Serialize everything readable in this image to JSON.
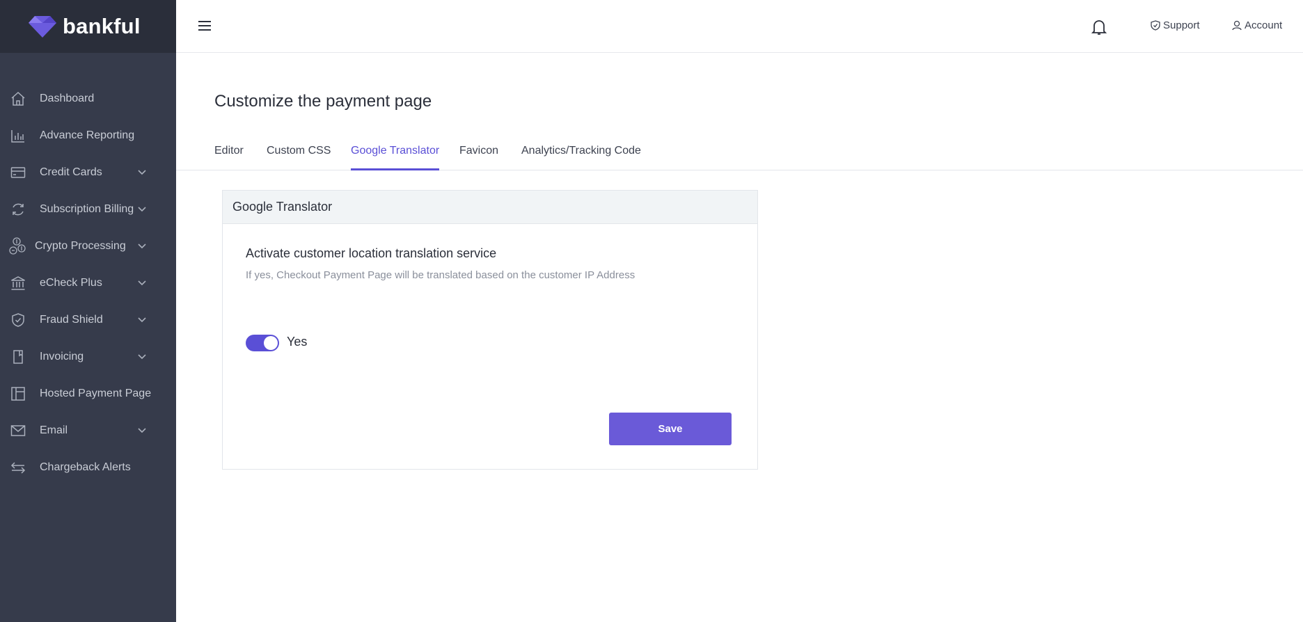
{
  "brand": {
    "name": "bankful",
    "accent": "#5a4fd6"
  },
  "sidebar": {
    "items": [
      {
        "label": "Dashboard",
        "icon": "home-icon",
        "has_submenu": false
      },
      {
        "label": "Advance Reporting",
        "icon": "bar-chart-icon",
        "has_submenu": false
      },
      {
        "label": "Credit Cards",
        "icon": "credit-card-icon",
        "has_submenu": true
      },
      {
        "label": "Subscription Billing",
        "icon": "refresh-icon",
        "has_submenu": true
      },
      {
        "label": "Crypto Processing",
        "icon": "crypto-coins-icon",
        "has_submenu": true
      },
      {
        "label": "eCheck Plus",
        "icon": "bank-icon",
        "has_submenu": true
      },
      {
        "label": "Fraud Shield",
        "icon": "shield-icon",
        "has_submenu": true
      },
      {
        "label": "Invoicing",
        "icon": "invoice-icon",
        "has_submenu": true
      },
      {
        "label": "Hosted Payment Page",
        "icon": "layout-icon",
        "has_submenu": false
      },
      {
        "label": "Email",
        "icon": "mail-icon",
        "has_submenu": true
      },
      {
        "label": "Chargeback Alerts",
        "icon": "transfer-arrows-icon",
        "has_submenu": false
      }
    ]
  },
  "header": {
    "support_label": "Support",
    "account_label": "Account"
  },
  "page": {
    "title": "Customize the payment page",
    "tabs": [
      {
        "label": "Editor",
        "active": false
      },
      {
        "label": "Custom CSS",
        "active": false
      },
      {
        "label": "Google Translator",
        "active": true
      },
      {
        "label": "Favicon",
        "active": false
      },
      {
        "label": "Analytics/Tracking Code",
        "active": false
      }
    ]
  },
  "card": {
    "header": "Google Translator",
    "setting_title": "Activate customer location translation service",
    "setting_description": "If yes, Checkout Payment Page will be translated based on the customer IP Address",
    "toggle_on": true,
    "toggle_label": "Yes",
    "save_label": "Save"
  }
}
